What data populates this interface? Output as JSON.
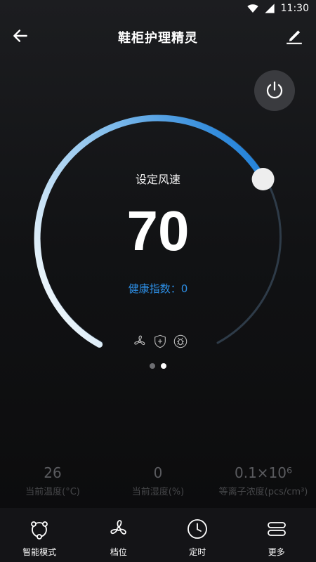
{
  "status_bar": {
    "time": "11:30"
  },
  "header": {
    "title": "鞋柜护理精灵"
  },
  "dial": {
    "label": "设定风速",
    "value": "70",
    "level_fraction": 0.7,
    "health_label": "健康指数：",
    "health_value": "0"
  },
  "pager": {
    "count": 2,
    "active": 2
  },
  "readings": [
    {
      "value": "26",
      "label": "当前温度(°C)"
    },
    {
      "value": "0",
      "label": "当前湿度(%)"
    },
    {
      "value": "0.1×10⁶",
      "label": "等离子浓度(pcs/cm³)"
    }
  ],
  "bottom_nav": [
    {
      "label": "智能模式",
      "icon": "smart-mode-icon"
    },
    {
      "label": "档位",
      "icon": "fan-icon"
    },
    {
      "label": "定时",
      "icon": "clock-icon"
    },
    {
      "label": "更多",
      "icon": "menu-icon"
    }
  ],
  "colors": {
    "accent": "#2d8fe6",
    "arc_start": "#eef6fb",
    "arc_end": "#1e7fd8",
    "arc_track": "#2e3b48",
    "background": "#141417"
  }
}
